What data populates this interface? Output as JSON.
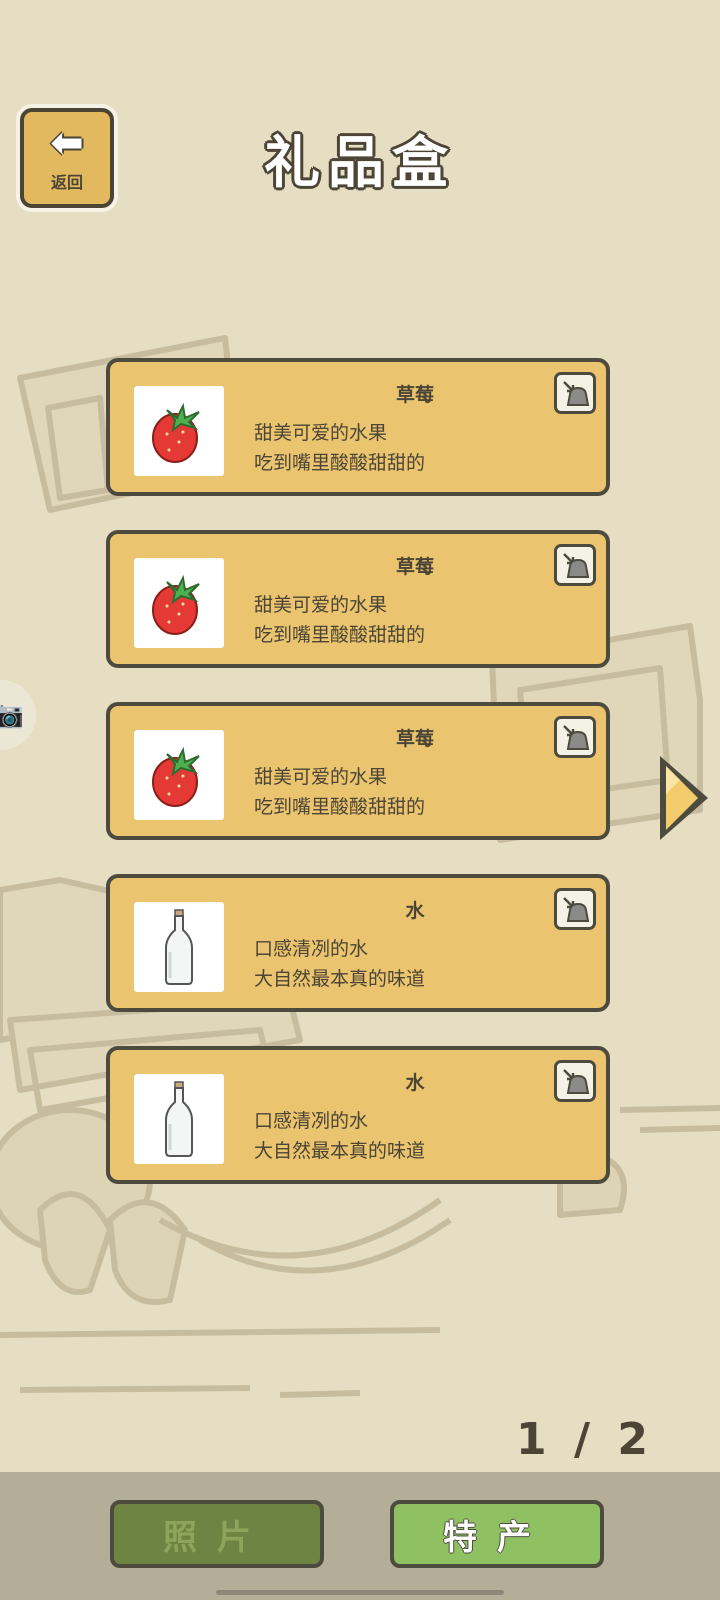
{
  "header": {
    "back_label": "返回",
    "title": "礼品盒"
  },
  "icons": {
    "back": "back-arrow-icon",
    "camera": "camera-icon",
    "store": "store-to-bag-icon",
    "next": "next-page-arrow-icon",
    "strawberry": "strawberry-icon",
    "bottle": "water-bottle-icon"
  },
  "items": [
    {
      "name": "草莓",
      "line1": "甜美可爱的水果",
      "line2": "吃到嘴里酸酸甜甜的",
      "icon": "strawberry"
    },
    {
      "name": "草莓",
      "line1": "甜美可爱的水果",
      "line2": "吃到嘴里酸酸甜甜的",
      "icon": "strawberry"
    },
    {
      "name": "草莓",
      "line1": "甜美可爱的水果",
      "line2": "吃到嘴里酸酸甜甜的",
      "icon": "strawberry"
    },
    {
      "name": "水",
      "line1": "口感清冽的水",
      "line2": "大自然最本真的味道",
      "icon": "bottle"
    },
    {
      "name": "水",
      "line1": "口感清冽的水",
      "line2": "大自然最本真的味道",
      "icon": "bottle"
    }
  ],
  "pager": {
    "current": "1",
    "separator": "/",
    "total": "2"
  },
  "tabs": {
    "photos": "照片",
    "specialty": "特产"
  },
  "colors": {
    "background": "#e6dec3",
    "card": "#eac46e",
    "outline": "#4c4b3e",
    "tab_photos": "#6e8442",
    "tab_specialty": "#8fc062"
  }
}
